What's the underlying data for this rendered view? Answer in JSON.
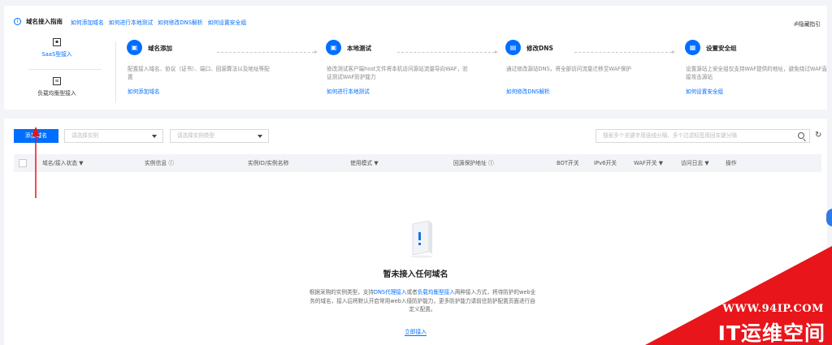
{
  "guide": {
    "title": "域名接入指南",
    "links": [
      "如何添加域名",
      "如何进行本地测试",
      "如何修改DNS解析",
      "如何设置安全组"
    ],
    "hide_label": "隐藏指引",
    "modes": [
      {
        "label": "SaaS型接入",
        "icon": "saas-icon"
      },
      {
        "label": "负载均衡型接入",
        "icon": "load-balancer-icon"
      }
    ],
    "steps": [
      {
        "title": "域名添加",
        "desc": "配置接入域名、协议（证书）、端口、回源算法以及地址等配置",
        "link": "如何添加域名"
      },
      {
        "title": "本地测试",
        "desc": "修改测试客户端host文件将本机访问源站流量导向WAF，验证测试WAF防护能力",
        "link": "如何进行本地测试"
      },
      {
        "title": "修改DNS",
        "desc": "通过修改源站DNS，将全部访问流量迁移至WAF保护",
        "link": "如何修改DNS解析"
      },
      {
        "title": "设置安全组",
        "desc": "设置源站上安全组仅支持WAF提供的地址，避免绕过WAF直接攻击源站",
        "link": "如何设置安全组"
      }
    ]
  },
  "toolbar": {
    "add_label": "添加域名",
    "select_instance_placeholder": "请选择实例",
    "select_type_placeholder": "请选择实例类型",
    "search_placeholder": "搜索多个关键字用竖线分隔，多个过滤标签用回车键分隔"
  },
  "table": {
    "columns": [
      "域名/接入状态",
      "实例信息",
      "实例ID/实例名称",
      "使用模式",
      "回源保护地址",
      "BOT开关",
      "IPv6开关",
      "WAF开关",
      "访问日志",
      "操作"
    ]
  },
  "empty": {
    "title": "暂未接入任何域名",
    "desc_1": "根据采购的实例类型，支持",
    "desc_link1": "DNS代理接入",
    "desc_2": "或者",
    "desc_link2": "负载均衡型接入",
    "desc_3": "两种接入方式，将待防护的web业务的域名，接入后将默认开启常用web入侵防护能力，更多防护能力请前往防护配置页面进行自定义配置。",
    "action": "立即接入"
  },
  "watermark": {
    "url": "WWW.94IP.COM",
    "name": "IT运维空间"
  },
  "colors": {
    "primary": "#006eff",
    "watermark_red": "#e8161b"
  }
}
